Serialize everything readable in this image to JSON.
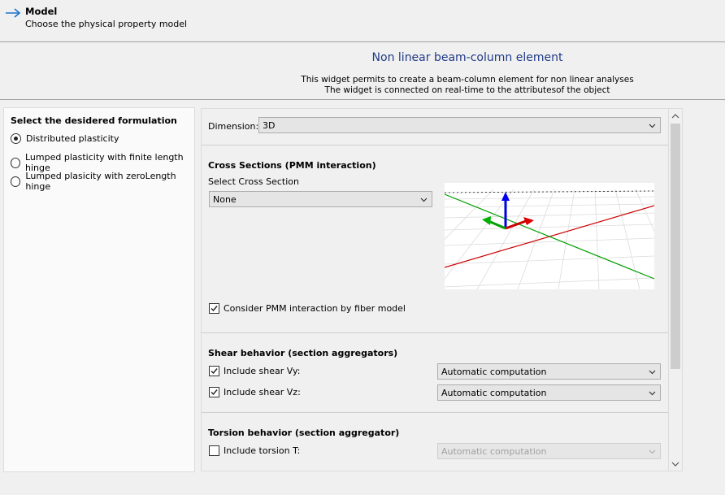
{
  "header": {
    "title": "Model",
    "subtitle": "Choose the physical property model",
    "icon": "arrow-right-icon"
  },
  "widget": {
    "title": "Non linear beam-column element",
    "desc_line1": "This widget permits to create a beam-column element for non linear analyses",
    "desc_line2": "The widget is connected on real-time to the attributesof the object"
  },
  "formulation": {
    "title": "Select the desidered formulation",
    "options": [
      {
        "label": "Distributed plasticity",
        "selected": true
      },
      {
        "label": "Lumped plasticity with finite length hinge",
        "selected": false
      },
      {
        "label": "Lumped plasicity with zeroLength hinge",
        "selected": false
      }
    ]
  },
  "dimension": {
    "label": "Dimension:",
    "value": "3D"
  },
  "cross_sections": {
    "title": "Cross Sections (PMM interaction)",
    "select_label": "Select Cross Section",
    "select_value": "None",
    "pmm_checkbox_label": "Consider PMM interaction by fiber model",
    "pmm_checked": true
  },
  "shear": {
    "title": "Shear behavior (section aggregators)",
    "vy_label": "Include shear Vy:",
    "vy_checked": true,
    "vy_value": "Automatic computation",
    "vz_label": "Include shear Vz:",
    "vz_checked": true,
    "vz_value": "Automatic computation"
  },
  "torsion": {
    "title": "Torsion behavior (section aggregator)",
    "t_label": "Include torsion T:",
    "t_checked": false,
    "t_value": "Automatic computation"
  },
  "colors": {
    "title_blue": "#1f3a87",
    "axis_x": "#cc0000",
    "axis_y": "#00a000",
    "axis_z": "#0000dd"
  }
}
